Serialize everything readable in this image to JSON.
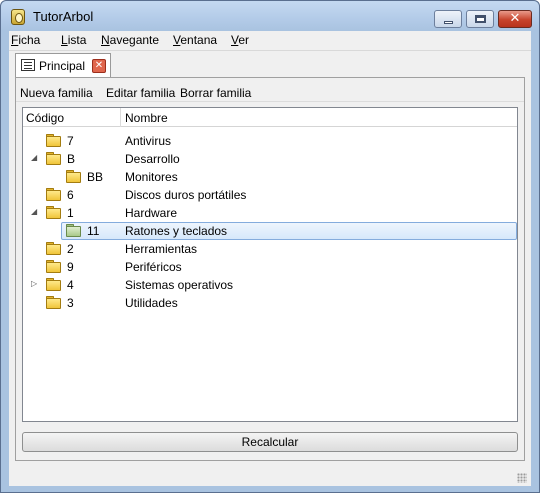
{
  "window": {
    "title": "TutorArbol"
  },
  "menu": [
    {
      "mnemonic": "F",
      "rest": "icha"
    },
    {
      "mnemonic": "L",
      "rest": "ista"
    },
    {
      "mnemonic": "N",
      "rest": "avegante"
    },
    {
      "mnemonic": "V",
      "rest": "entana"
    },
    {
      "mnemonic": "V",
      "rest": "er"
    }
  ],
  "tab": {
    "label": "Principal",
    "icon": "form-icon"
  },
  "toolbar": {
    "new": "Nueva familia",
    "edit": "Editar familia",
    "delete": "Borrar familia"
  },
  "tree": {
    "columns": {
      "code": "Código",
      "name": "Nombre"
    },
    "rows": [
      {
        "code": "7",
        "name": "Antivirus",
        "expander": ""
      },
      {
        "code": "B",
        "name": "Desarrollo",
        "expander": "◢"
      },
      {
        "code": "BB",
        "name": "Monitores",
        "expander": ""
      },
      {
        "code": "6",
        "name": "Discos duros portátiles",
        "expander": ""
      },
      {
        "code": "1",
        "name": "Hardware",
        "expander": "◢"
      },
      {
        "code": "11",
        "name": "Ratones y teclados",
        "expander": ""
      },
      {
        "code": "2",
        "name": "Herramientas",
        "expander": ""
      },
      {
        "code": "9",
        "name": "Periféricos",
        "expander": ""
      },
      {
        "code": "4",
        "name": "Sistemas operativos",
        "expander": "▷"
      },
      {
        "code": "3",
        "name": "Utilidades",
        "expander": ""
      }
    ]
  },
  "recalc_label": "Recalcular",
  "colors": {
    "selection": "#d6e8fb",
    "titlebar": "#b3cbe8",
    "close": "#c7432c"
  }
}
